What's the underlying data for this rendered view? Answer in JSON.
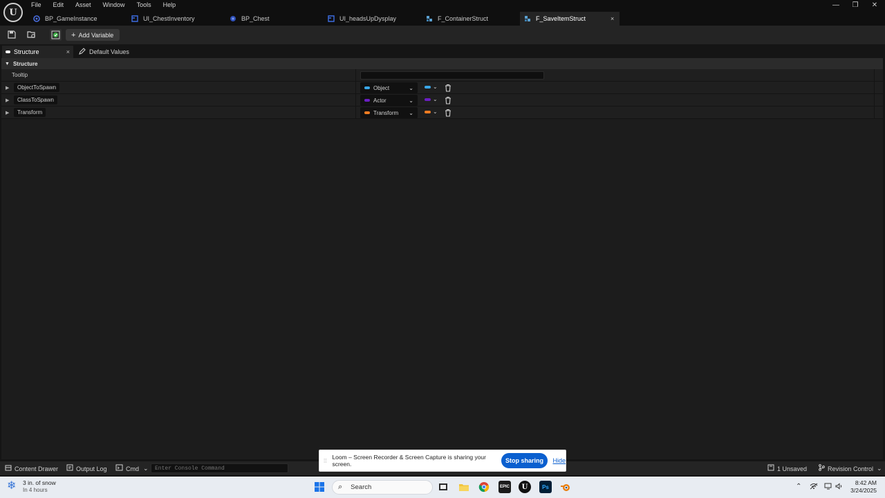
{
  "menu": [
    "File",
    "Edit",
    "Asset",
    "Window",
    "Tools",
    "Help"
  ],
  "window_controls": {
    "minimize": "—",
    "restore": "❐",
    "close": "✕"
  },
  "tabs": [
    {
      "label": "BP_GameInstance",
      "icon": "blueprint-icon",
      "color": "#4a6ee0"
    },
    {
      "label": "UI_ChestInventory",
      "icon": "widget-icon",
      "color": "#3d6de0"
    },
    {
      "label": "BP_Chest",
      "icon": "blueprint-icon",
      "color": "#4a6ee0"
    },
    {
      "label": "UI_headsUpDysplay",
      "icon": "widget-icon",
      "color": "#3d6de0"
    },
    {
      "label": "F_ContainerStruct",
      "icon": "struct-icon",
      "color": "#5aa0d0"
    },
    {
      "label": "F_SaveItemStruct",
      "icon": "struct-icon",
      "color": "#5aa0d0",
      "active": true,
      "close": "×"
    }
  ],
  "toolbar": {
    "add_variable_label": "Add Variable",
    "add_variable_plus": "+"
  },
  "panel_tabs": {
    "structure": "Structure",
    "structure_close": "×",
    "default_values": "Default Values"
  },
  "details": {
    "section_title": "Structure",
    "tooltip_label": "Tooltip",
    "tooltip_value": "",
    "variables": [
      {
        "name": "ObjectToSpawn",
        "type": "Object",
        "color": "#39a7e8"
      },
      {
        "name": "ClassToSpawn",
        "type": "Actor",
        "color": "#6a1fc2"
      },
      {
        "name": "Transform",
        "type": "Transform",
        "color": "#f07c22"
      }
    ]
  },
  "statusbar": {
    "content_drawer": "Content Drawer",
    "output_log": "Output Log",
    "cmd": "Cmd",
    "console_placeholder": "Enter Console Command",
    "unsaved": "1 Unsaved",
    "revision_control": "Revision Control"
  },
  "loom": {
    "message": "Loom – Screen Recorder & Screen Capture is sharing your screen.",
    "stop_label": "Stop sharing",
    "hide_label": "Hide"
  },
  "taskbar": {
    "weather_temp": "3 in. of snow",
    "weather_sub": "In 4 hours",
    "search_label": "Search",
    "time": "8:42 AM",
    "date": "3/24/2025"
  },
  "colors": {
    "accent_blue": "#0a5fcf",
    "object_pin": "#39a7e8",
    "actor_pin": "#6a1fc2",
    "transform_pin": "#f07c22"
  }
}
